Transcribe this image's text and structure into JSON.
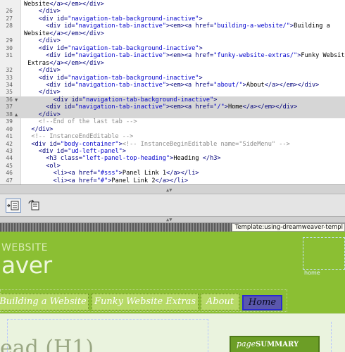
{
  "editor": {
    "lines": [
      {
        "n": "",
        "fold": "",
        "hl": false,
        "indent": 0,
        "segs": [
          [
            "t-text",
            "Website"
          ],
          [
            "t-tag",
            "</a></em></div>"
          ]
        ]
      },
      {
        "n": "26",
        "fold": "",
        "hl": false,
        "indent": 4,
        "segs": [
          [
            "t-tag",
            "</div>"
          ]
        ]
      },
      {
        "n": "27",
        "fold": "",
        "hl": false,
        "indent": 4,
        "segs": [
          [
            "t-tag",
            "<div "
          ],
          [
            "t-attr",
            "id="
          ],
          [
            "t-str",
            "\"navigation-tab-background-inactive\""
          ],
          [
            "t-tag",
            ">"
          ]
        ]
      },
      {
        "n": "28",
        "fold": "",
        "hl": false,
        "indent": 6,
        "segs": [
          [
            "t-tag",
            "<div "
          ],
          [
            "t-attr",
            "id="
          ],
          [
            "t-str",
            "\"navigation-tab-inactive\""
          ],
          [
            "t-tag",
            "><em><a "
          ],
          [
            "t-attr",
            "href="
          ],
          [
            "t-str",
            "\"building-a-website/\""
          ],
          [
            "t-tag",
            ">"
          ],
          [
            "t-text",
            "Building a"
          ]
        ]
      },
      {
        "n": "",
        "fold": "",
        "hl": false,
        "indent": 0,
        "segs": [
          [
            "t-text",
            "Website"
          ],
          [
            "t-tag",
            "</a></em></div>"
          ]
        ]
      },
      {
        "n": "29",
        "fold": "",
        "hl": false,
        "indent": 4,
        "segs": [
          [
            "t-tag",
            "</div>"
          ]
        ]
      },
      {
        "n": "30",
        "fold": "",
        "hl": false,
        "indent": 4,
        "segs": [
          [
            "t-tag",
            "<div "
          ],
          [
            "t-attr",
            "id="
          ],
          [
            "t-str",
            "\"navigation-tab-background-inactive\""
          ],
          [
            "t-tag",
            ">"
          ]
        ]
      },
      {
        "n": "31",
        "fold": "",
        "hl": false,
        "indent": 6,
        "segs": [
          [
            "t-tag",
            "<div "
          ],
          [
            "t-attr",
            "id="
          ],
          [
            "t-str",
            "\"navigation-tab-inactive\""
          ],
          [
            "t-tag",
            "><em><a "
          ],
          [
            "t-attr",
            "href="
          ],
          [
            "t-str",
            "\"funky-website-extras/\""
          ],
          [
            "t-tag",
            ">"
          ],
          [
            "t-text",
            "Funky Website"
          ]
        ]
      },
      {
        "n": "",
        "fold": "",
        "hl": false,
        "indent": 1,
        "segs": [
          [
            "t-text",
            "Extras"
          ],
          [
            "t-tag",
            "</a></em></div>"
          ]
        ]
      },
      {
        "n": "32",
        "fold": "",
        "hl": false,
        "indent": 4,
        "segs": [
          [
            "t-tag",
            "</div>"
          ]
        ]
      },
      {
        "n": "33",
        "fold": "",
        "hl": false,
        "indent": 4,
        "segs": [
          [
            "t-tag",
            "<div "
          ],
          [
            "t-attr",
            "id="
          ],
          [
            "t-str",
            "\"navigation-tab-background-inactive\""
          ],
          [
            "t-tag",
            ">"
          ]
        ]
      },
      {
        "n": "34",
        "fold": "",
        "hl": false,
        "indent": 6,
        "segs": [
          [
            "t-tag",
            "<div "
          ],
          [
            "t-attr",
            "id="
          ],
          [
            "t-str",
            "\"navigation-tab-inactive\""
          ],
          [
            "t-tag",
            "><em><a "
          ],
          [
            "t-attr",
            "href="
          ],
          [
            "t-str",
            "\"about/\""
          ],
          [
            "t-tag",
            ">"
          ],
          [
            "t-text",
            "About"
          ],
          [
            "t-tag",
            "</a></em></div>"
          ]
        ]
      },
      {
        "n": "35",
        "fold": "",
        "hl": false,
        "indent": 4,
        "segs": [
          [
            "t-tag",
            "</div>"
          ]
        ]
      },
      {
        "n": "36",
        "fold": "▼",
        "hl": true,
        "indent": 8,
        "segs": [
          [
            "t-tag",
            "<div "
          ],
          [
            "t-attr",
            "id="
          ],
          [
            "t-str",
            "\"navigation-tab-background-inactive\""
          ],
          [
            "t-tag",
            ">"
          ]
        ]
      },
      {
        "n": "37",
        "fold": "",
        "hl": true,
        "indent": 6,
        "segs": [
          [
            "t-tag",
            "<div "
          ],
          [
            "t-attr",
            "id="
          ],
          [
            "t-str",
            "\"navigation-tab-inactive\""
          ],
          [
            "t-tag",
            "><em><a "
          ],
          [
            "t-attr",
            "href="
          ],
          [
            "t-str",
            "\"/\""
          ],
          [
            "t-tag",
            ">"
          ],
          [
            "t-text",
            "Home"
          ],
          [
            "t-tag",
            "</a></em></div>"
          ]
        ]
      },
      {
        "n": "38",
        "fold": "▲",
        "hl": true,
        "indent": 4,
        "segs": [
          [
            "t-tag",
            "</div>"
          ]
        ]
      },
      {
        "n": "39",
        "fold": "",
        "hl": false,
        "indent": 4,
        "segs": [
          [
            "t-comment",
            "<!--End of the last tab -->"
          ]
        ]
      },
      {
        "n": "40",
        "fold": "",
        "hl": false,
        "indent": 2,
        "segs": [
          [
            "t-tag",
            "</div>"
          ]
        ]
      },
      {
        "n": "41",
        "fold": "",
        "hl": false,
        "indent": 2,
        "segs": [
          [
            "t-comment",
            "<!-- InstanceEndEditable -->"
          ]
        ]
      },
      {
        "n": "42",
        "fold": "",
        "hl": false,
        "indent": 2,
        "segs": [
          [
            "t-tag",
            "<div "
          ],
          [
            "t-attr",
            "id="
          ],
          [
            "t-str",
            "\"body-container\""
          ],
          [
            "t-tag",
            ">"
          ],
          [
            "t-comment",
            "<!-- InstanceBeginEditable name=\"SideMenu\" -->"
          ]
        ]
      },
      {
        "n": "43",
        "fold": "",
        "hl": false,
        "indent": 4,
        "segs": [
          [
            "t-tag",
            "<div "
          ],
          [
            "t-attr",
            "id="
          ],
          [
            "t-str",
            "\"ud-left-panel\""
          ],
          [
            "t-tag",
            ">"
          ]
        ]
      },
      {
        "n": "44",
        "fold": "",
        "hl": false,
        "indent": 6,
        "segs": [
          [
            "t-tag",
            "<h3 "
          ],
          [
            "t-attr",
            "class="
          ],
          [
            "t-str",
            "\"left-panel-top-heading\""
          ],
          [
            "t-tag",
            ">"
          ],
          [
            "t-text",
            "Heading "
          ],
          [
            "t-tag",
            "</h3>"
          ]
        ]
      },
      {
        "n": "45",
        "fold": "",
        "hl": false,
        "indent": 6,
        "segs": [
          [
            "t-tag",
            "<ol>"
          ]
        ]
      },
      {
        "n": "46",
        "fold": "",
        "hl": false,
        "indent": 8,
        "segs": [
          [
            "t-tag",
            "<li><a "
          ],
          [
            "t-attr",
            "href="
          ],
          [
            "t-str",
            "\"#sss\""
          ],
          [
            "t-tag",
            ">"
          ],
          [
            "t-text",
            "Panel Link 1"
          ],
          [
            "t-tag",
            "</a></li>"
          ]
        ]
      },
      {
        "n": "47",
        "fold": "",
        "hl": false,
        "indent": 8,
        "segs": [
          [
            "t-tag",
            "<li><a "
          ],
          [
            "t-attr",
            "href="
          ],
          [
            "t-str",
            "\"#\""
          ],
          [
            "t-tag",
            ">"
          ],
          [
            "t-text",
            "Panel Link 2"
          ],
          [
            "t-tag",
            "</a></li>"
          ]
        ]
      }
    ]
  },
  "toolbar": {
    "buttons": [
      {
        "name": "code-navigator-button",
        "icon": "indent-icon",
        "active": true
      },
      {
        "name": "refresh-design-button",
        "icon": "refresh-icon",
        "active": false
      }
    ]
  },
  "design": {
    "template_label": "Template:using-dreamweaver-templ",
    "site_subtitle": "WEBSITE",
    "site_title": "aver",
    "home_label": "home",
    "nav_tabs": [
      {
        "label": "Building a Website",
        "active": false
      },
      {
        "label": "Funky Website Extras",
        "active": false
      },
      {
        "label": "About",
        "active": false
      },
      {
        "label": "Home",
        "active": true
      }
    ],
    "page_heading": "ead (H1)",
    "side_heading_prefix": "page",
    "side_heading_suffix": "SUMMARY"
  }
}
